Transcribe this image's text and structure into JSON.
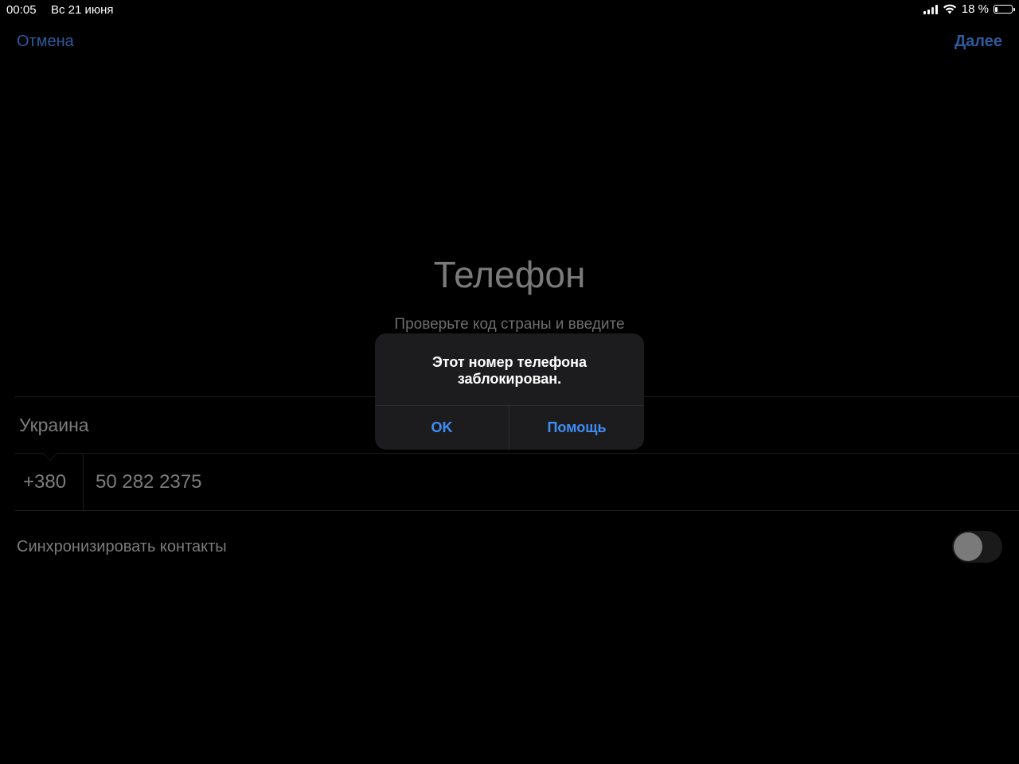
{
  "status_bar": {
    "time": "00:05",
    "date": "Вс 21 июня",
    "battery_percent_label": "18 %",
    "battery_level": 0.18,
    "signal_icon": "cellular-signal-icon",
    "wifi_icon": "wifi-icon",
    "battery_icon": "battery-icon"
  },
  "nav": {
    "cancel_label": "Отмена",
    "next_label": "Далее"
  },
  "header": {
    "title": "Телефон",
    "subtitle": "Проверьте код страны и введите"
  },
  "form": {
    "country": "Украина",
    "country_code": "+380",
    "phone_number": "50 282 2375",
    "sync_contacts_label": "Синхронизировать контакты",
    "sync_contacts_enabled": false
  },
  "alert": {
    "message_line1": "Этот номер телефона",
    "message_line2": "заблокирован.",
    "ok_label": "OK",
    "help_label": "Помощь"
  },
  "colors": {
    "accent_dim": "#2f5a9e",
    "alert_button": "#3e8ef5",
    "background": "#000000",
    "alert_background": "#1c1c1e"
  }
}
